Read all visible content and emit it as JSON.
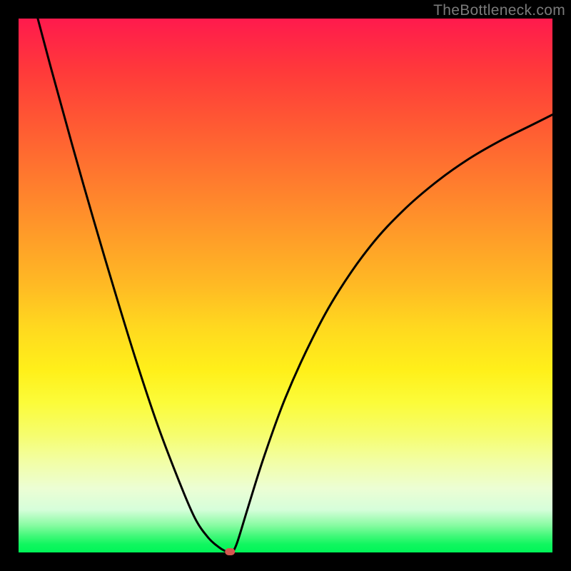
{
  "watermark": "TheBottleneck.com",
  "chart_data": {
    "type": "line",
    "title": "",
    "xlabel": "",
    "ylabel": "",
    "xlim": [
      0,
      100
    ],
    "ylim": [
      0,
      100
    ],
    "grid": false,
    "legend": false,
    "annotations": [],
    "series": [
      {
        "name": "left-descent",
        "x": [
          3.6,
          6,
          10,
          14,
          18,
          22,
          26,
          30,
          33,
          35.5,
          37.5,
          38.8,
          39.2
        ],
        "y": [
          100,
          91,
          76.5,
          62.5,
          49,
          36,
          24,
          13.5,
          6.5,
          2.8,
          1,
          0.2,
          0
        ]
      },
      {
        "name": "right-ascent",
        "x": [
          40.1,
          41,
          43,
          46,
          50,
          55,
          60,
          66,
          72,
          78,
          84,
          90,
          96,
          100
        ],
        "y": [
          0,
          2,
          8.5,
          18,
          29,
          40,
          49,
          57.5,
          64,
          69.2,
          73.5,
          77,
          80,
          82
        ]
      }
    ],
    "marker": {
      "x": 39.6,
      "y": 0,
      "color": "#d4574f"
    },
    "background_gradient": {
      "top": "#ff1a4d",
      "mid": "#ffd91f",
      "bottom": "#00f558"
    }
  }
}
